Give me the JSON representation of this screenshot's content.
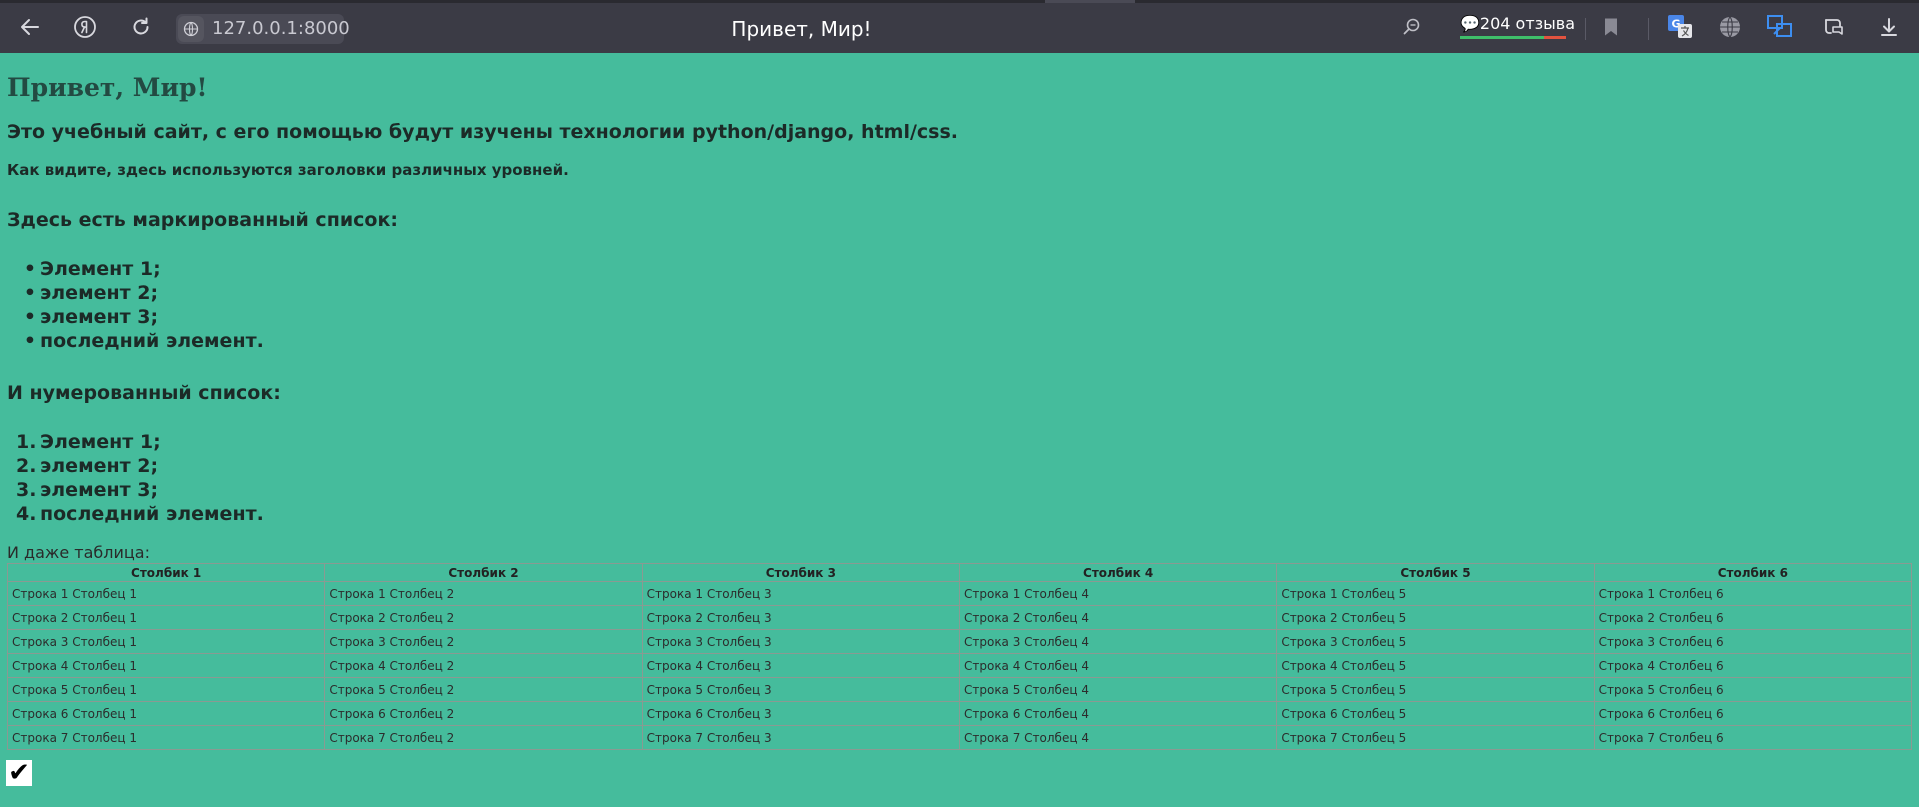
{
  "browser": {
    "url": "127.0.0.1:8000",
    "tab_title": "Привет, Мир!",
    "reviews": "204 отзыва",
    "icons": [
      "back-icon",
      "yandex-icon",
      "reload-icon",
      "site-info-icon",
      "zoom-icon",
      "comment-icon",
      "bookmark-icon",
      "translate-icon",
      "globe-icon",
      "screenshot-icon",
      "alice-icon",
      "download-icon"
    ]
  },
  "page": {
    "h1": "Привет, Мир!",
    "h2": "Это учебный сайт, с его помощью будут изучены технологии python/django, html/css.",
    "h4": "Как видите, здесь используются заголовки различных уровней.",
    "bullet_heading": "Здесь есть маркированный список:",
    "bullet_items": [
      "Элемент 1;",
      "элемент 2;",
      "элемент 3;",
      "последний элемент."
    ],
    "numbered_heading": "И нумерованный список:",
    "numbered_items": [
      "Элемент 1;",
      "элемент 2;",
      "элемент 3;",
      "последний элемент."
    ],
    "table_caption": "И даже таблица:",
    "table": {
      "headers": [
        "Столбик 1",
        "Столбик 2",
        "Столбик 3",
        "Столбик 4",
        "Столбик 5",
        "Столбик 6"
      ],
      "rows": [
        [
          "Строка 1 Столбец 1",
          "Строка 1 Столбец 2",
          "Строка 1 Столбец 3",
          "Строка 1 Столбец 4",
          "Строка 1 Столбец 5",
          "Строка 1 Столбец 6"
        ],
        [
          "Строка 2 Столбец 1",
          "Строка 2 Столбец 2",
          "Строка 2 Столбец 3",
          "Строка 2 Столбец 4",
          "Строка 2 Столбец 5",
          "Строка 2 Столбец 6"
        ],
        [
          "Строка 3 Столбец 1",
          "Строка 3 Столбец 2",
          "Строка 3 Столбец 3",
          "Строка 3 Столбец 4",
          "Строка 3 Столбец 5",
          "Строка 3 Столбец 6"
        ],
        [
          "Строка 4 Столбец 1",
          "Строка 4 Столбец 2",
          "Строка 4 Столбец 3",
          "Строка 4 Столбец 4",
          "Строка 4 Столбец 5",
          "Строка 4 Столбец 6"
        ],
        [
          "Строка 5 Столбец 1",
          "Строка 5 Столбец 2",
          "Строка 5 Столбец 3",
          "Строка 5 Столбец 4",
          "Строка 5 Столбец 5",
          "Строка 5 Столбец 6"
        ],
        [
          "Строка 6 Столбец 1",
          "Строка 6 Столбец 2",
          "Строка 6 Столбец 3",
          "Строка 6 Столбец 4",
          "Строка 6 Столбец 5",
          "Строка 6 Столбец 6"
        ],
        [
          "Строка 7 Столбец 1",
          "Строка 7 Столбец 2",
          "Строка 7 Столбец 3",
          "Строка 7 Столбец 4",
          "Строка 7 Столбец 5",
          "Строка 7 Столбец 6"
        ]
      ]
    },
    "check_mark": "✔"
  },
  "colors": {
    "page_background": "#45bc9c",
    "toolbar_background": "#3b3b45",
    "heading_text": "#234a42",
    "body_text": "#1c2a27"
  }
}
